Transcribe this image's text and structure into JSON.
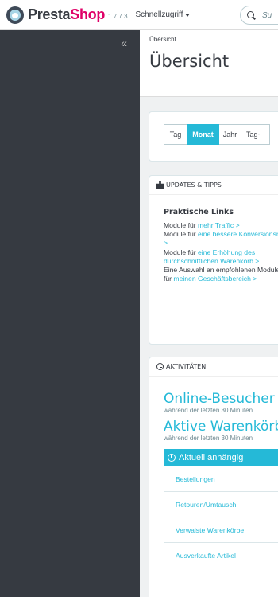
{
  "topbar": {
    "logo_presta": "Presta",
    "logo_shop": "Shop",
    "version": "1.7.7.3",
    "quick_access": "Schnellzugriff",
    "search_placeholder": "Su"
  },
  "sidebar": {
    "collapse_glyph": "«"
  },
  "header": {
    "breadcrumb": "Übersicht",
    "title": "Übersicht"
  },
  "period": {
    "buttons": [
      "Tag",
      "Monat",
      "Jahr",
      "Tag-"
    ],
    "active": "Monat"
  },
  "updates": {
    "heading": "UPDATES & TIPPS",
    "links_title": "Praktische Links",
    "l1_text": "Module für ",
    "l1_link": "mehr Traffic >",
    "l2_text": "Module für ",
    "l2_link": "eine bessere Konversionsrate >",
    "l3_text": "Module für ",
    "l3_link": "eine Erhöhung des durchschnittlichen Warenkorb >",
    "l4_text": "Eine Auswahl an empfohlenen Modulen für ",
    "l4_link": "meinen Geschäftsbereich >"
  },
  "activity": {
    "heading": "AKTIVITÄTEN",
    "visitors_title": "Online-Besucher",
    "visitors_sub": "während der letzten 30 Minuten",
    "carts_title": "Aktive Warenkörbe",
    "carts_sub": "während der letzten 30 Minuten",
    "pending_title": "Aktuell anhängig",
    "pending_items": [
      "Bestellungen",
      "Retouren/Umtausch",
      "Verwaiste Warenkörbe",
      "Ausverkaufte Artikel"
    ]
  },
  "colors": {
    "accent": "#25b9d7",
    "brand": "#df0067",
    "sidebar": "#363a41"
  }
}
